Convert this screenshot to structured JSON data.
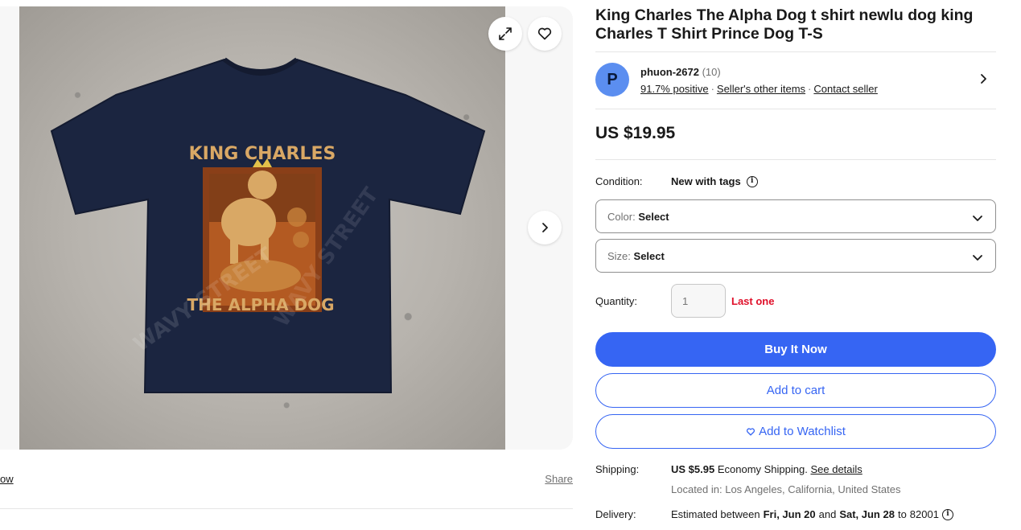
{
  "gallery": {
    "expand_icon": "expand-icon",
    "watch_icon": "heart-icon",
    "next_icon": "chevron-right-icon",
    "shirt_print_top": "KING CHARLES",
    "shirt_print_bottom": "THE ALPHA DOG",
    "watermark": "WAVY STREET",
    "left_link": "ow",
    "share_label": "Share"
  },
  "product": {
    "title": "King Charles The Alpha Dog t shirt newlu dog king Charles T Shirt Prince Dog T-S",
    "price": "US $19.95"
  },
  "seller": {
    "avatar_letter": "P",
    "name": "phuon-2672",
    "count": "(10)",
    "positive": "91.7% positive",
    "other_items": "Seller's other items",
    "contact": "Contact seller",
    "dot": "·"
  },
  "condition": {
    "label": "Condition:",
    "value": "New with tags"
  },
  "color_select": {
    "label": "Color:",
    "value": "Select"
  },
  "size_select": {
    "label": "Size:",
    "value": "Select"
  },
  "quantity": {
    "label": "Quantity:",
    "value": "1",
    "stock_note": "Last one"
  },
  "actions": {
    "buy_now": "Buy It Now",
    "add_to_cart": "Add to cart",
    "watchlist": "Add to Watchlist"
  },
  "shipping": {
    "label": "Shipping:",
    "cost": "US $5.95",
    "method": "Economy Shipping.",
    "details_link": "See details",
    "location": "Located in: Los Angeles, California, United States"
  },
  "delivery": {
    "label": "Delivery:",
    "prefix": "Estimated between",
    "start": "Fri, Jun 20",
    "and": "and",
    "end": "Sat, Jun 28",
    "to": "to",
    "zip": "82001"
  },
  "colors": {
    "accent": "#3665f3",
    "alert": "#e0102a",
    "shirt": "#1b2540",
    "print": "#d9a865"
  }
}
